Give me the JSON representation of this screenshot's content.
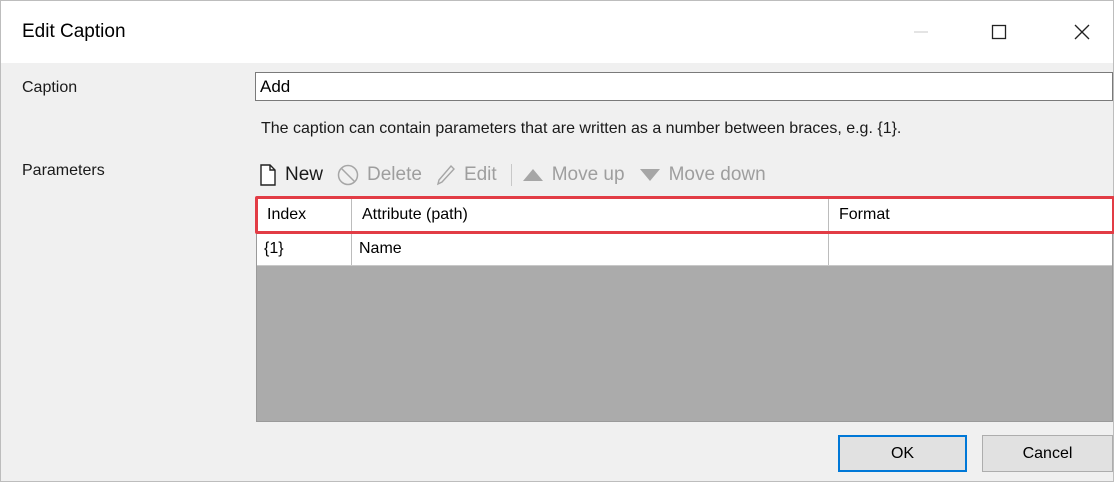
{
  "window": {
    "title": "Edit Caption"
  },
  "caption": {
    "label": "Caption",
    "value": "Add",
    "help": "The caption can contain parameters that are written as a number between braces, e.g. {1}."
  },
  "parameters": {
    "label": "Parameters",
    "toolbar": {
      "new": "New",
      "delete": "Delete",
      "edit": "Edit",
      "move_up": "Move up",
      "move_down": "Move down"
    },
    "columns": [
      "Index",
      "Attribute (path)",
      "Format"
    ],
    "rows": [
      {
        "index": "{1}",
        "attribute": "Name",
        "format": ""
      }
    ]
  },
  "buttons": {
    "ok": "OK",
    "cancel": "Cancel"
  },
  "colors": {
    "highlight": "#e23c45",
    "default_button_border": "#0078d7",
    "grid_empty": "#ababab"
  }
}
